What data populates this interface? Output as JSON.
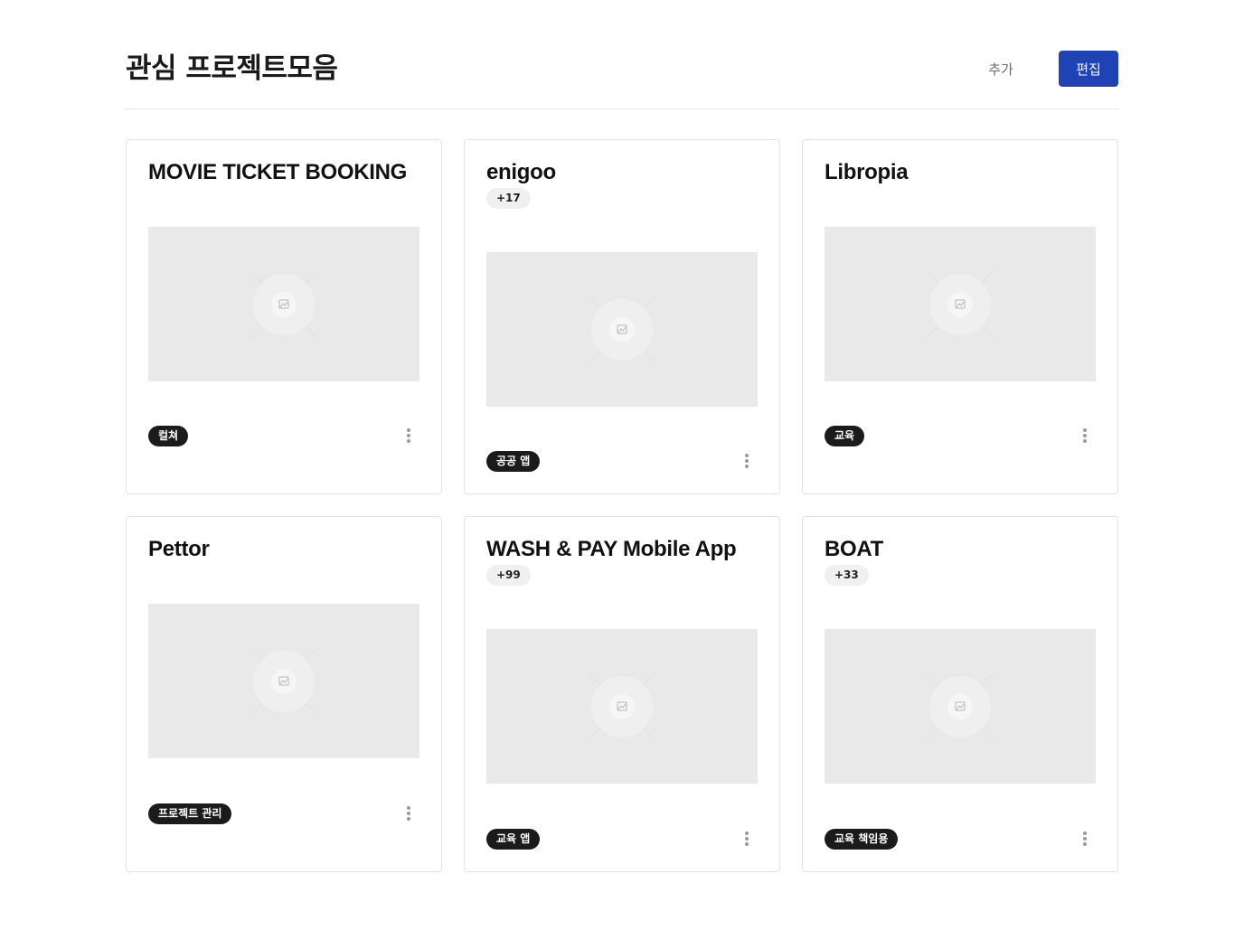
{
  "header": {
    "title": "관심 프로젝트모음",
    "add_label": "추가",
    "edit_label": "편집"
  },
  "colors": {
    "accent": "#1f42b5",
    "tag_bg": "#1b1b1b",
    "thumb_bg": "#e9e9e9"
  },
  "cards": [
    {
      "title": "MOVIE TICKET BOOKING",
      "count": "",
      "tag": "컬쳐",
      "thumbnail_icon": "image-placeholder-icon",
      "menu_icon": "more-vertical-icon"
    },
    {
      "title": "enigoo",
      "count": "+17",
      "tag": "공공 앱",
      "thumbnail_icon": "image-placeholder-icon",
      "menu_icon": "more-vertical-icon"
    },
    {
      "title": "Libropia",
      "count": "",
      "tag": "교육",
      "thumbnail_icon": "image-placeholder-icon",
      "menu_icon": "more-vertical-icon"
    },
    {
      "title": "Pettor",
      "count": "",
      "tag": "프로젝트 관리",
      "thumbnail_icon": "image-placeholder-icon",
      "menu_icon": "more-vertical-icon"
    },
    {
      "title": "WASH & PAY Mobile App",
      "count": "+99",
      "tag": "교육 앱",
      "thumbnail_icon": "image-placeholder-icon",
      "menu_icon": "more-vertical-icon"
    },
    {
      "title": "BOAT",
      "count": "+33",
      "tag": "교육 책임용",
      "thumbnail_icon": "image-placeholder-icon",
      "menu_icon": "more-vertical-icon"
    }
  ]
}
